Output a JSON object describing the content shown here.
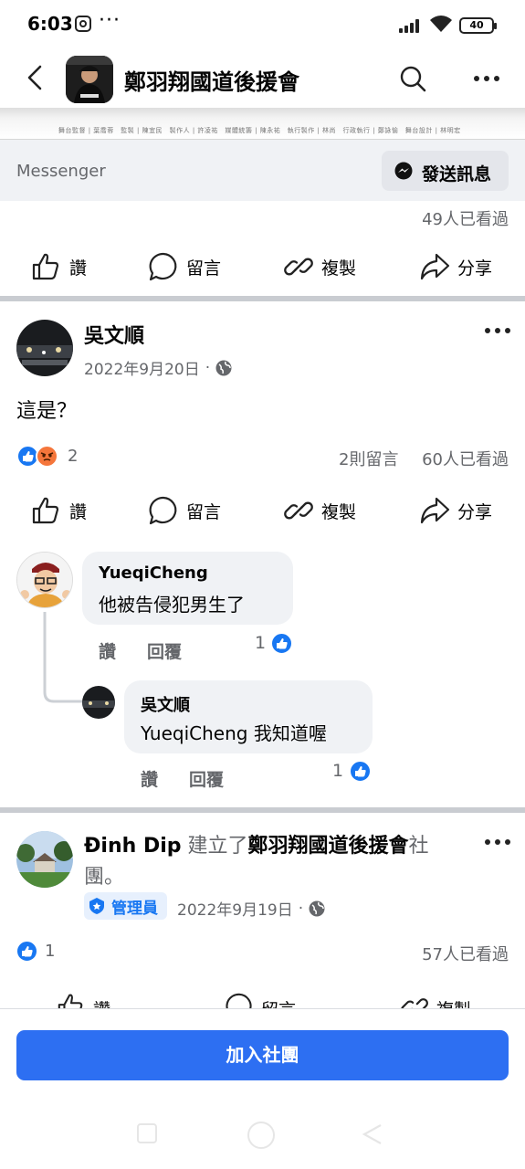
{
  "status_bar": {
    "time": "6:03",
    "dots": "···",
    "battery": "40"
  },
  "header": {
    "title": "鄭羽翔國道後援會"
  },
  "cover": {
    "credits": "舞台監督 | 葉喬蓉　監製 | 陳宜民　製作人 | 許凌祐　媒體統籌 | 陳永祐　執行製作 | 林尚　行政執行 | 鄭詠愉　舞台設計 | 林明宏"
  },
  "messenger": {
    "label": "Messenger",
    "send_label": "發送訊息"
  },
  "post0": {
    "views": "49人已看過"
  },
  "actions": {
    "like": "讚",
    "comment": "留言",
    "copy": "複製",
    "share": "分享"
  },
  "post1": {
    "author": "吳文順",
    "date": "2022年9月20日",
    "sep": "·",
    "text": "這是？",
    "reaction_count": "2",
    "comment_count": "2則留言",
    "views": "60人已看過"
  },
  "comments": [
    {
      "author": "YueqiCheng",
      "text": "他被告侵犯男生了",
      "like": "讚",
      "reply": "回覆",
      "likes": "1"
    },
    {
      "author": "吳文順",
      "text": "YueqiCheng 我知道喔",
      "like": "讚",
      "reply": "回覆",
      "likes": "1"
    }
  ],
  "post2": {
    "author": "Đinh Dip",
    "created": "建立了",
    "group": "鄭羽翔國道後援會",
    "suffix": "社",
    "line2": "團。",
    "badge": "管理員",
    "date": "2022年9月19日",
    "sep": "·",
    "reaction_count": "1",
    "views": "57人已看過"
  },
  "join": {
    "label": "加入社團"
  },
  "colors": {
    "accent": "#2d6ff2",
    "like_blue": "#1877f2",
    "angry": "#f5763b",
    "muted": "#65676b"
  }
}
